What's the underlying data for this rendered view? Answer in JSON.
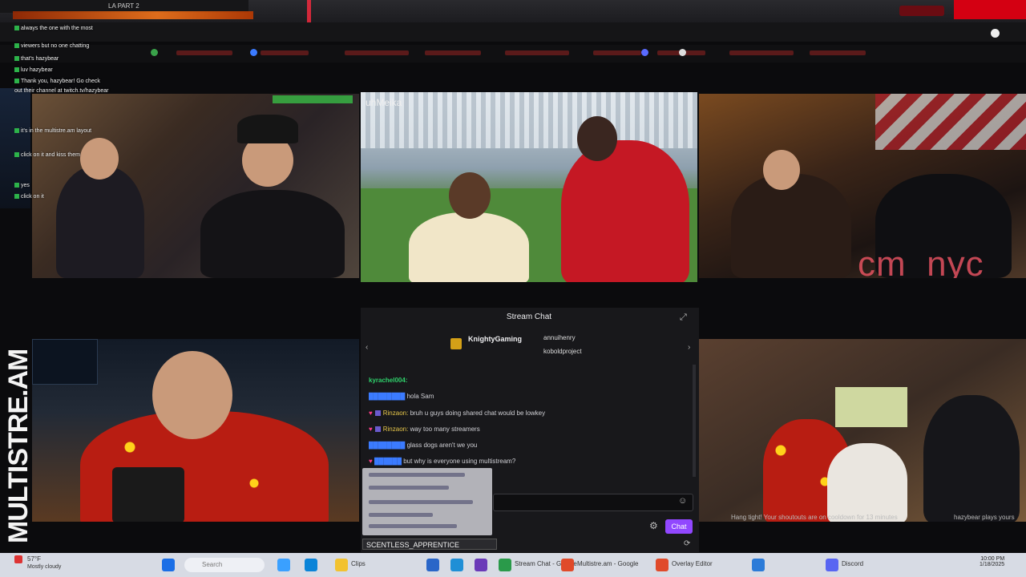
{
  "browser": {
    "tab_title": "LA PART 2"
  },
  "overlay_chat": {
    "lines": [
      {
        "user": "",
        "text": "always the one with the most"
      },
      {
        "user": "",
        "text": "viewers but no one chatting"
      },
      {
        "user": "",
        "text": "that's hazybear"
      },
      {
        "user": "",
        "text": "luv hazybear"
      },
      {
        "user": "",
        "text": "Thank you, hazybear! Go check"
      },
      {
        "user": "",
        "text": "out their channel at twitch.tv/hazybear"
      },
      {
        "user": "",
        "text": "it's in the multistre.am layout"
      },
      {
        "user": "",
        "text": "click on it and kiss them"
      },
      {
        "user": "",
        "text": "yes"
      },
      {
        "user": "",
        "text": "click on it"
      }
    ]
  },
  "tiles": {
    "top_center_label": "uhMeika",
    "top_right_name": "cm_nyc",
    "bottom_right_caption": "Hang tight! Your shoutouts are on cooldown for 13 minutes",
    "bottom_right_tag": "hazybear plays yours"
  },
  "logo": {
    "text": "MULTISTRE.AM"
  },
  "stream_chat": {
    "header": "Stream Chat",
    "featured": [
      {
        "name": "KnightyGaming"
      },
      {
        "name": "annuihenry"
      },
      {
        "name": "koboldproject"
      }
    ],
    "messages": [
      {
        "user": "kyrachel004:",
        "text": "",
        "style": "green"
      },
      {
        "user": "",
        "text": "hola Sam",
        "style": "blue"
      },
      {
        "user": "Rinzaon:",
        "text": "bruh u guys doing shared chat would be lowkey",
        "style": "yellow"
      },
      {
        "user": "Rinzaon:",
        "text": "way too many streamers",
        "style": "yellow"
      },
      {
        "user": "",
        "text": "glass dogs aren't we you",
        "style": "blue"
      },
      {
        "user": "",
        "text": "but why is everyone using multistream?",
        "style": "blue"
      }
    ],
    "send_label": "Chat",
    "window_label": "SCENTLESS_APPRENTICE"
  },
  "taskbar": {
    "weather": "57°F",
    "weather_sub": "Mostly cloudy",
    "search_placeholder": "Search",
    "items": [
      "Clips",
      "Stream Chat - Google",
      "Multistre.am - Google",
      "Overlay Editor",
      "Discord"
    ],
    "time": "10:00 PM",
    "date": "1/18/2025"
  },
  "colors": {
    "accent": "#9147ff",
    "stream_name": "#ff5a6a",
    "browser_red": "#d40012"
  }
}
